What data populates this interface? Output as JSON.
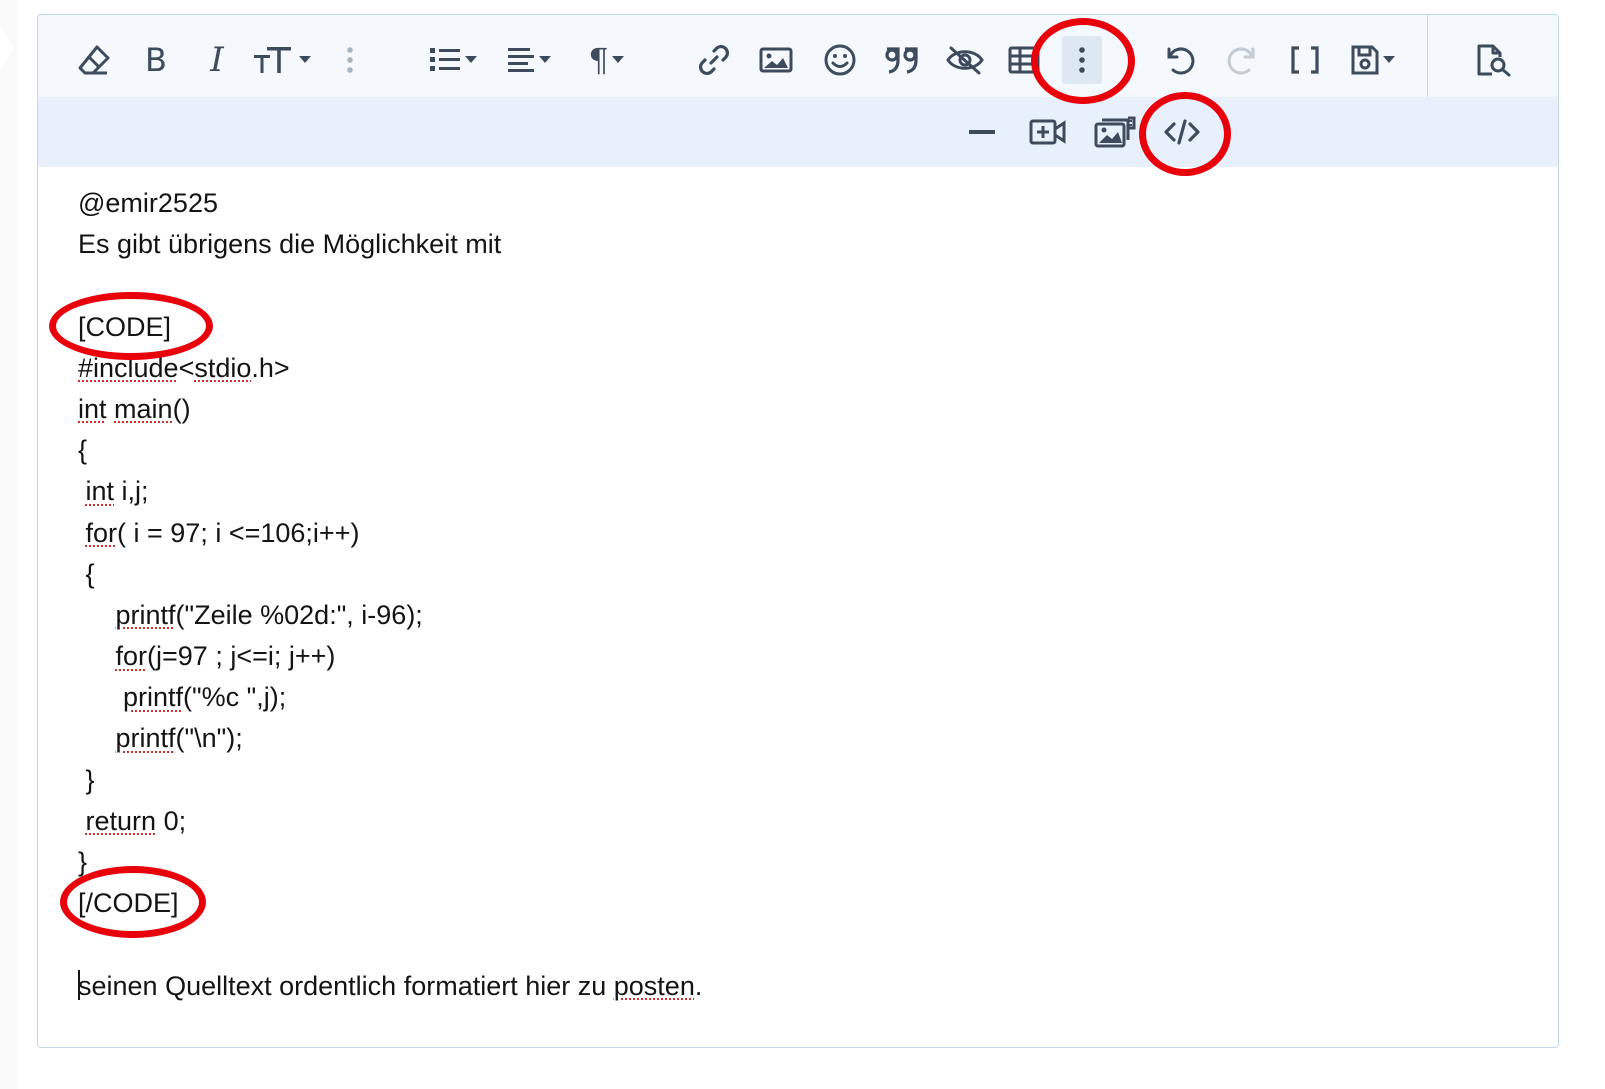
{
  "toolbar": {
    "main_buttons": [
      {
        "name": "eraser-icon",
        "label": "Remove formatting"
      },
      {
        "name": "bold-icon",
        "label": "B"
      },
      {
        "name": "italic-icon",
        "label": "I"
      },
      {
        "name": "font-size-icon",
        "label": "TT"
      },
      {
        "name": "more-text-icon",
        "label": "More text options"
      },
      {
        "name": "list-icon",
        "label": "List"
      },
      {
        "name": "align-icon",
        "label": "Alignment"
      },
      {
        "name": "paragraph-icon",
        "label": "¶"
      },
      {
        "name": "link-icon",
        "label": "Link"
      },
      {
        "name": "image-icon",
        "label": "Image"
      },
      {
        "name": "smiley-icon",
        "label": "Smilies"
      },
      {
        "name": "quote-icon",
        "label": "Quote"
      },
      {
        "name": "spoiler-icon",
        "label": "Spoiler"
      },
      {
        "name": "table-icon",
        "label": "Table"
      },
      {
        "name": "more-options-icon",
        "label": "More options"
      },
      {
        "name": "undo-icon",
        "label": "Undo"
      },
      {
        "name": "redo-icon",
        "label": "Redo"
      },
      {
        "name": "bbcode-toggle-icon",
        "label": "Toggle BB code"
      },
      {
        "name": "drafts-icon",
        "label": "Drafts"
      },
      {
        "name": "preview-icon",
        "label": "Preview"
      }
    ],
    "secondary_buttons": [
      {
        "name": "horizontal-line-icon",
        "label": "Horizontal line"
      },
      {
        "name": "insert-video-icon",
        "label": "Insert video"
      },
      {
        "name": "insert-gallery-icon",
        "label": "Insert gallery"
      },
      {
        "name": "code-icon",
        "label": "Code"
      }
    ]
  },
  "content": {
    "lines": [
      "@emir2525",
      "Es gibt übrigens die Möglichkeit mit",
      "",
      "[CODE]",
      "#include<stdio.h>",
      "int main()",
      "{",
      " int i,j;",
      " for( i = 97; i <=106;i++)",
      " {",
      "     printf(\"Zeile %02d:\", i-96);",
      "     for(j=97 ; j<=i; j++)",
      "      printf(\"%c \",j);",
      "     printf(\"\\n\");",
      " }",
      " return 0;",
      "}",
      "[/CODE]",
      "",
      "seinen Quelltext ordentlich formatiert hier zu posten."
    ]
  },
  "colors": {
    "annotation": "#e8000b",
    "toolbar_bg": "#f5f9fd",
    "secondary_toolbar_bg": "#e8f1fb",
    "icon": "#3d4b5c",
    "border": "#c3d7e7",
    "spellcheck": "#d23030"
  }
}
